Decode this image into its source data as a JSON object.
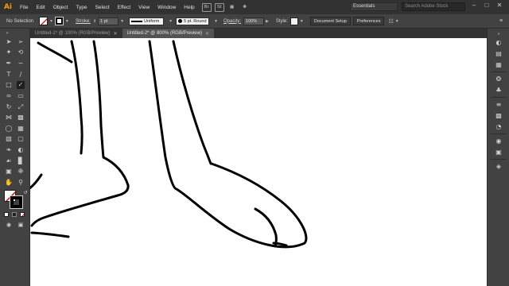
{
  "app": {
    "logo": "Ai",
    "menu": [
      "File",
      "Edit",
      "Object",
      "Type",
      "Select",
      "Effect",
      "View",
      "Window",
      "Help"
    ],
    "bridge_label": "Br",
    "stock_label": "St",
    "workspace": "Essentials",
    "search_placeholder": "Search Adobe Stock"
  },
  "control": {
    "selection_label": "No Selection",
    "stroke_label": "Stroke:",
    "stroke_weight": "1 pt",
    "profile_label": "Uniform",
    "brush_label": "5 pt. Round",
    "opacity_label": "Opacity:",
    "opacity_value": "100%",
    "style_label": "Style:",
    "document_setup": "Document Setup",
    "preferences": "Preferences"
  },
  "tabs": [
    {
      "label": "Untitled-1* @ 100% (RGB/Preview)",
      "active": false
    },
    {
      "label": "Untitled-2* @ 800% (RGB/Preview)",
      "active": true
    }
  ],
  "colors": {
    "fill": "#ffffff",
    "stroke": "#000000",
    "accent": "#ff9a00"
  },
  "icons": {
    "tools": [
      "selection-icon",
      "direct-selection-icon",
      "magic-wand-icon",
      "lasso-icon",
      "pen-icon",
      "curvature-icon",
      "type-icon",
      "line-segment-icon",
      "rectangle-icon",
      "paintbrush-icon",
      "shaper-icon",
      "eraser-icon",
      "rotate-icon",
      "scale-icon",
      "width-icon",
      "free-transform-icon",
      "shape-builder-icon",
      "perspective-grid-icon",
      "mesh-icon",
      "gradient-icon",
      "eyedropper-icon",
      "blend-icon",
      "symbol-sprayer-icon",
      "column-graph-icon",
      "artboard-icon",
      "slice-icon",
      "hand-icon",
      "zoom-icon"
    ],
    "panels": [
      "color-icon",
      "color-guide-icon",
      "swatches-icon",
      "brushes-icon",
      "symbols-icon",
      "stroke-icon",
      "gradient-panel-icon",
      "transparency-icon",
      "appearance-icon",
      "graphic-styles-icon",
      "layers-icon"
    ]
  }
}
